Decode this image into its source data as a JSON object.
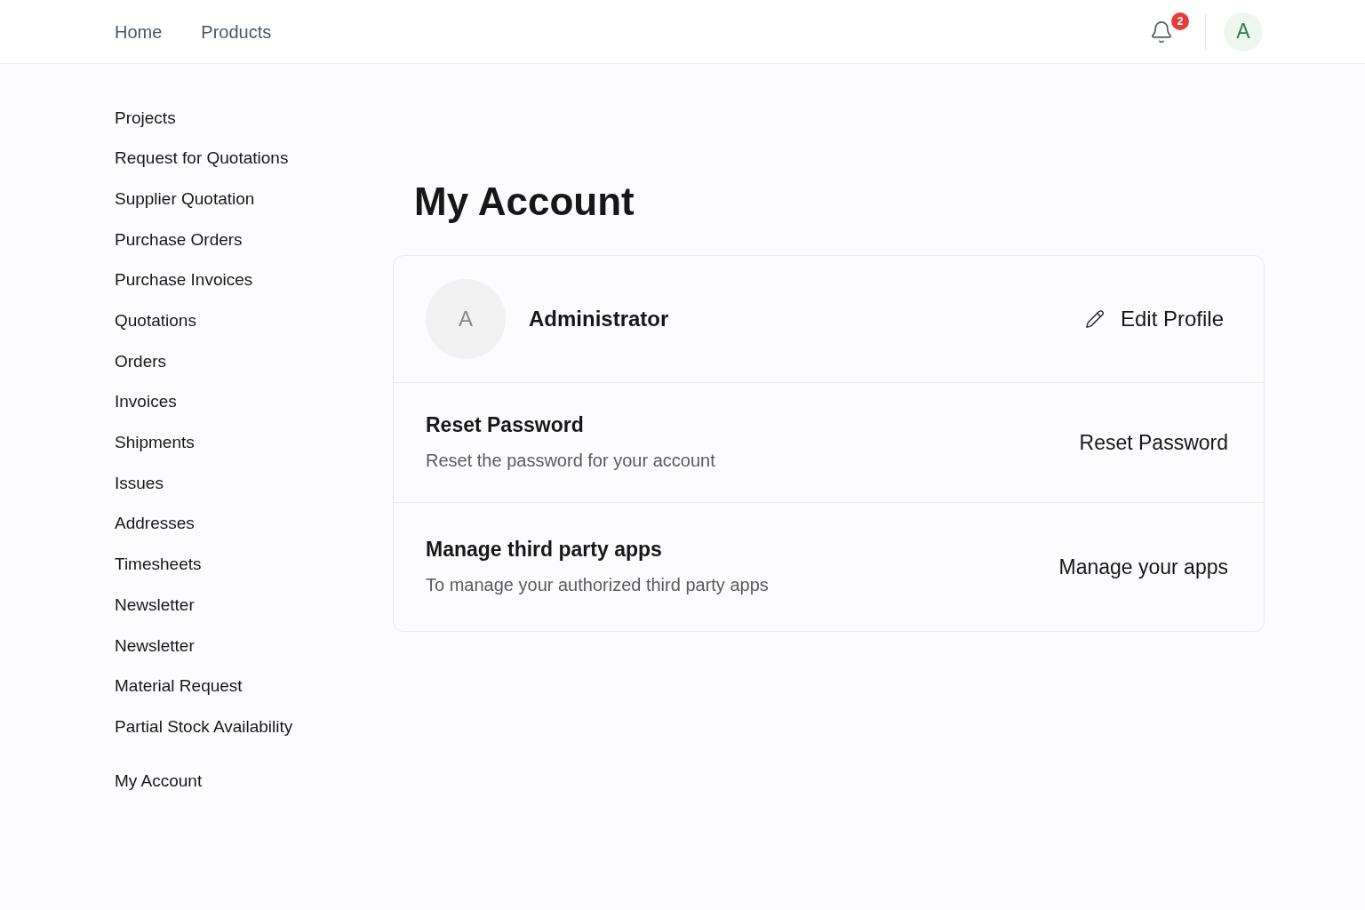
{
  "header": {
    "nav": [
      {
        "label": "Home"
      },
      {
        "label": "Products"
      }
    ],
    "notifications": {
      "count": "2"
    },
    "user_avatar": {
      "initial": "A"
    }
  },
  "sidebar": {
    "items": [
      {
        "label": "Projects"
      },
      {
        "label": "Request for Quotations"
      },
      {
        "label": "Supplier Quotation"
      },
      {
        "label": "Purchase Orders"
      },
      {
        "label": "Purchase Invoices"
      },
      {
        "label": "Quotations"
      },
      {
        "label": "Orders"
      },
      {
        "label": "Invoices"
      },
      {
        "label": "Shipments"
      },
      {
        "label": "Issues"
      },
      {
        "label": "Addresses"
      },
      {
        "label": "Timesheets"
      },
      {
        "label": "Newsletter"
      },
      {
        "label": "Newsletter"
      },
      {
        "label": "Material Request"
      },
      {
        "label": "Partial Stock Availability"
      }
    ],
    "footer_items": [
      {
        "label": "My Account"
      }
    ]
  },
  "main": {
    "title": "My Account",
    "profile": {
      "initial": "A",
      "name": "Administrator",
      "action": "Edit Profile"
    },
    "sections": [
      {
        "title": "Reset Password",
        "description": "Reset the password for your account",
        "action": "Reset Password"
      },
      {
        "title": "Manage third party apps",
        "description": "To manage your authorized third party apps",
        "action": "Manage your apps"
      }
    ]
  }
}
